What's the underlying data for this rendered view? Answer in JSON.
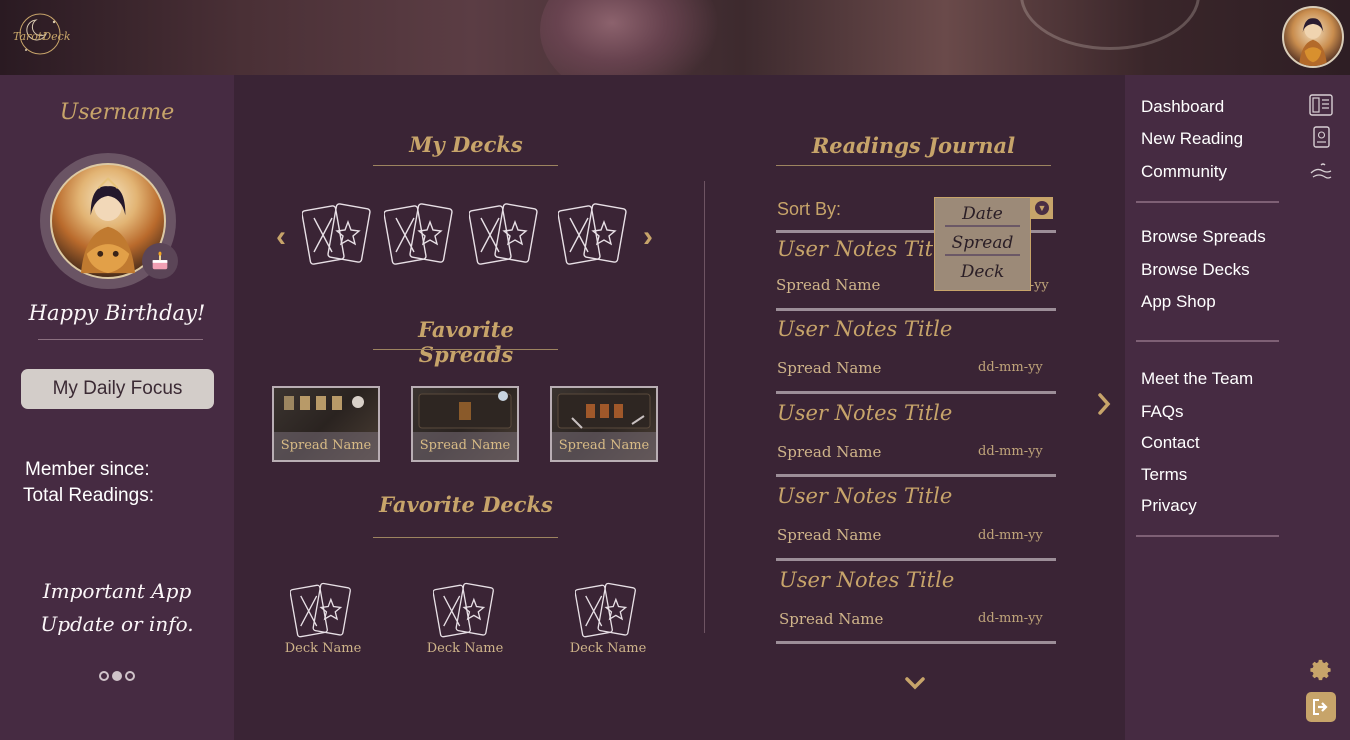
{
  "header": {
    "logo_text": "TarotDeck"
  },
  "left": {
    "username": "Username",
    "birthday": "Happy Birthday!",
    "focus_button": "My Daily Focus",
    "member_since": "Member since:",
    "total_readings": "Total Readings:",
    "update_line1": "Important App",
    "update_line2": "Update or info."
  },
  "decks": {
    "title": "My Decks"
  },
  "spreads": {
    "title": "Favorite Spreads",
    "items": [
      {
        "label": "Spread Name"
      },
      {
        "label": "Spread Name"
      },
      {
        "label": "Spread Name"
      }
    ]
  },
  "fav_decks": {
    "title": "Favorite Decks",
    "items": [
      {
        "label": "Deck Name"
      },
      {
        "label": "Deck Name"
      },
      {
        "label": "Deck Name"
      }
    ]
  },
  "journal": {
    "title": "Readings Journal",
    "sort_label": "Sort By:",
    "sort_options": [
      "Date",
      "Spread",
      "Deck"
    ],
    "entries": [
      {
        "title": "User Notes Title",
        "spread": "Spread Name",
        "date": "dd-mm-yy"
      },
      {
        "title": "User Notes Title",
        "spread": "Spread Name",
        "date": "dd-mm-yy"
      },
      {
        "title": "User Notes Title",
        "spread": "Spread Name",
        "date": "dd-mm-yy"
      },
      {
        "title": "User Notes Title",
        "spread": "Spread Name",
        "date": "dd-mm-yy"
      },
      {
        "title": "User Notes Title",
        "spread": "Spread Name",
        "date": "dd-mm-yy"
      }
    ]
  },
  "nav": {
    "group1": [
      "Dashboard",
      "New Reading",
      "Community"
    ],
    "group2": [
      "Browse Spreads",
      "Browse Decks",
      "App Shop"
    ],
    "group3": [
      "Meet the Team",
      "FAQs",
      "Contact",
      "Terms",
      "Privacy"
    ]
  },
  "colors": {
    "accent_gold": "#c7a46a",
    "sidebar_bg": "#462b42",
    "main_bg": "#3a2435"
  }
}
